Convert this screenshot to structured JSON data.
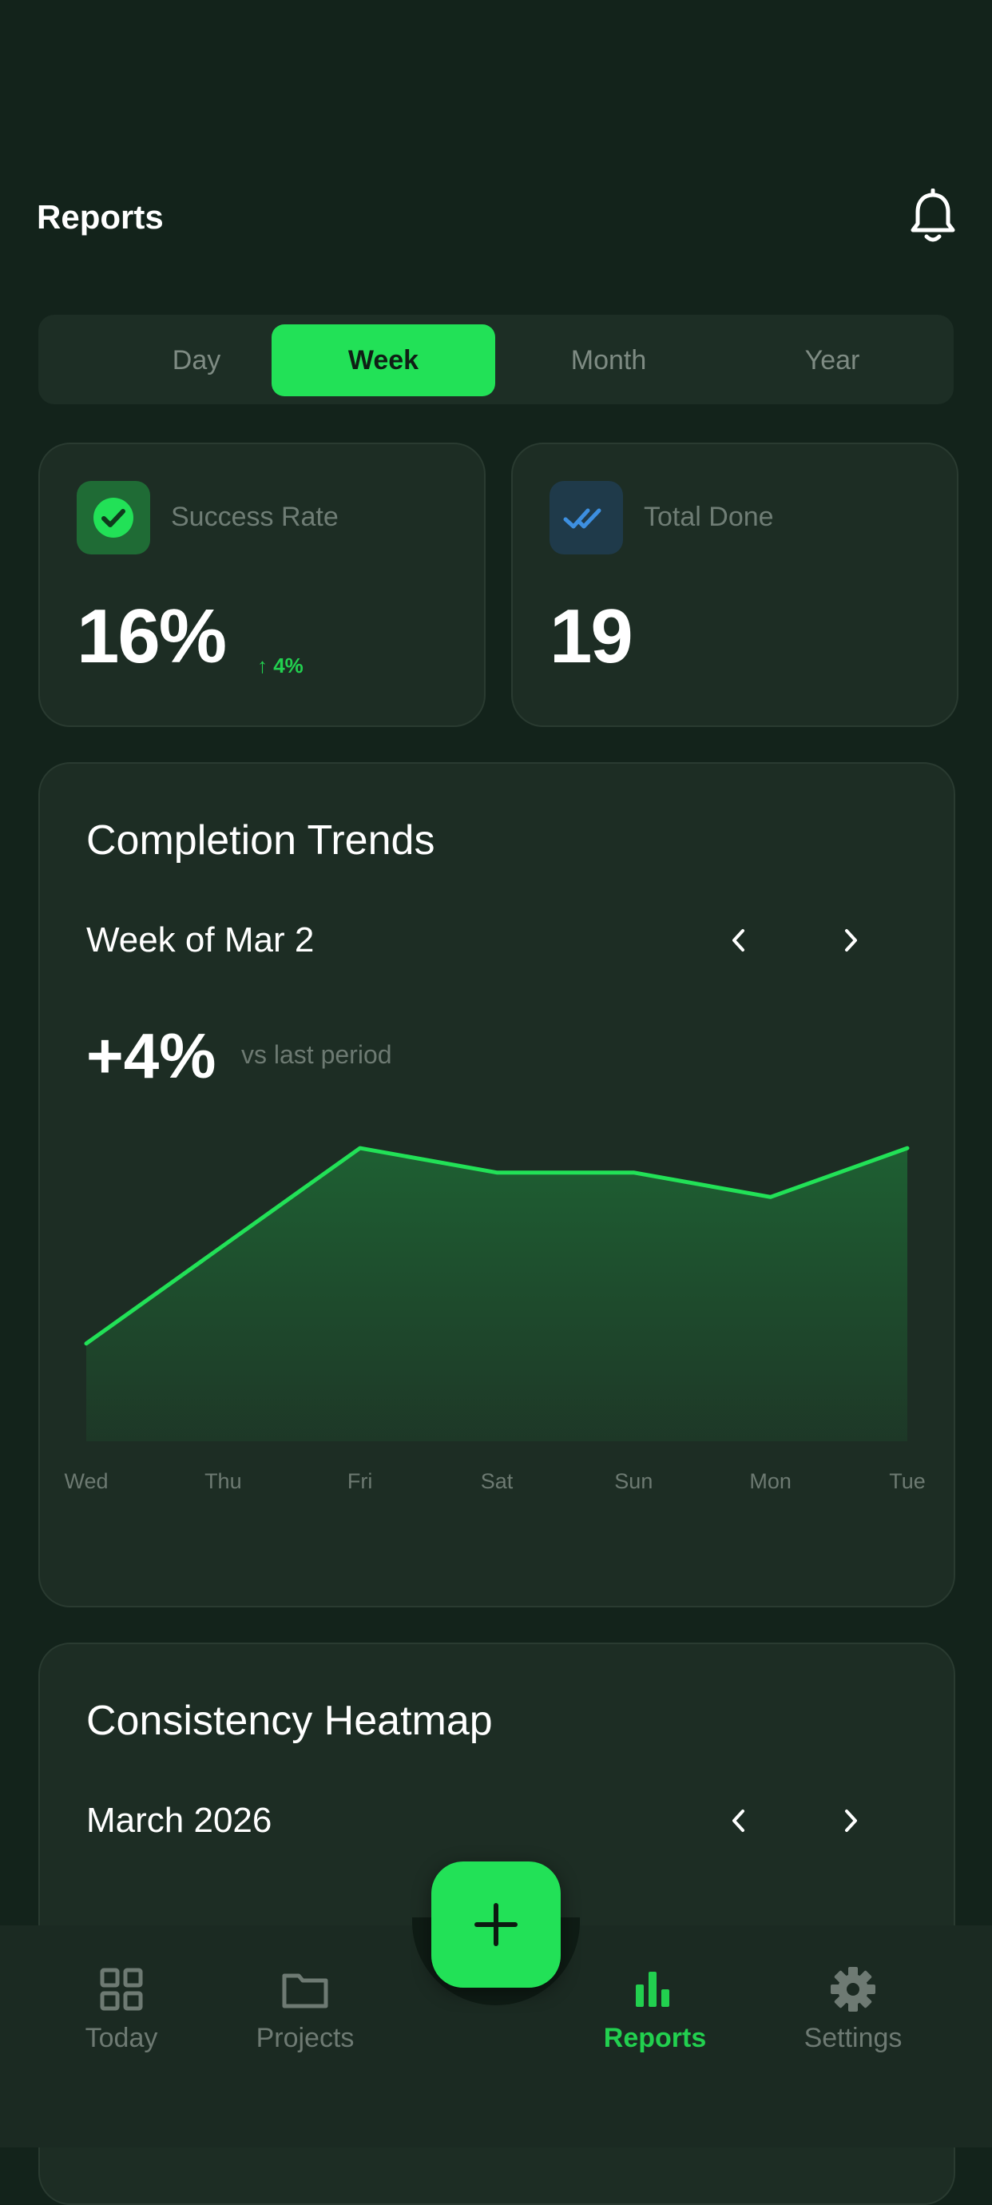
{
  "header": {
    "title": "Reports",
    "notification_icon": "bell-icon"
  },
  "period_tabs": [
    {
      "label": "Day",
      "active": false
    },
    {
      "label": "Week",
      "active": true
    },
    {
      "label": "Month",
      "active": false
    },
    {
      "label": "Year",
      "active": false
    }
  ],
  "stats": {
    "success_rate": {
      "label": "Success Rate",
      "value": "16%",
      "delta": "↑ 4%",
      "icon": "check-circle-icon"
    },
    "total_done": {
      "label": "Total Done",
      "value": "19",
      "icon": "double-check-icon"
    }
  },
  "completion_trends": {
    "title": "Completion Trends",
    "period_label": "Week of Mar 2",
    "change": "+4%",
    "change_note": "vs last period",
    "chart_data": {
      "type": "area",
      "categories": [
        "Wed",
        "Thu",
        "Fri",
        "Sat",
        "Sun",
        "Mon",
        "Tue"
      ],
      "values": [
        10,
        14,
        18,
        17,
        17,
        16,
        18
      ],
      "ylim": [
        6,
        20
      ],
      "grid": false,
      "color": "#22e157"
    }
  },
  "consistency_heatmap": {
    "title": "Consistency Heatmap",
    "month_label": "March 2026"
  },
  "bottom_nav": {
    "items": [
      {
        "label": "Today",
        "icon": "grid-icon",
        "active": false
      },
      {
        "label": "Projects",
        "icon": "folder-icon",
        "active": false
      },
      {
        "label": "Reports",
        "icon": "bar-chart-icon",
        "active": true
      },
      {
        "label": "Settings",
        "icon": "gear-icon",
        "active": false
      }
    ],
    "add_button_icon": "plus-icon"
  },
  "colors": {
    "accent": "#22e157",
    "background": "#13231b",
    "card": "#1d2d24",
    "muted_text": "#6f7d75"
  }
}
